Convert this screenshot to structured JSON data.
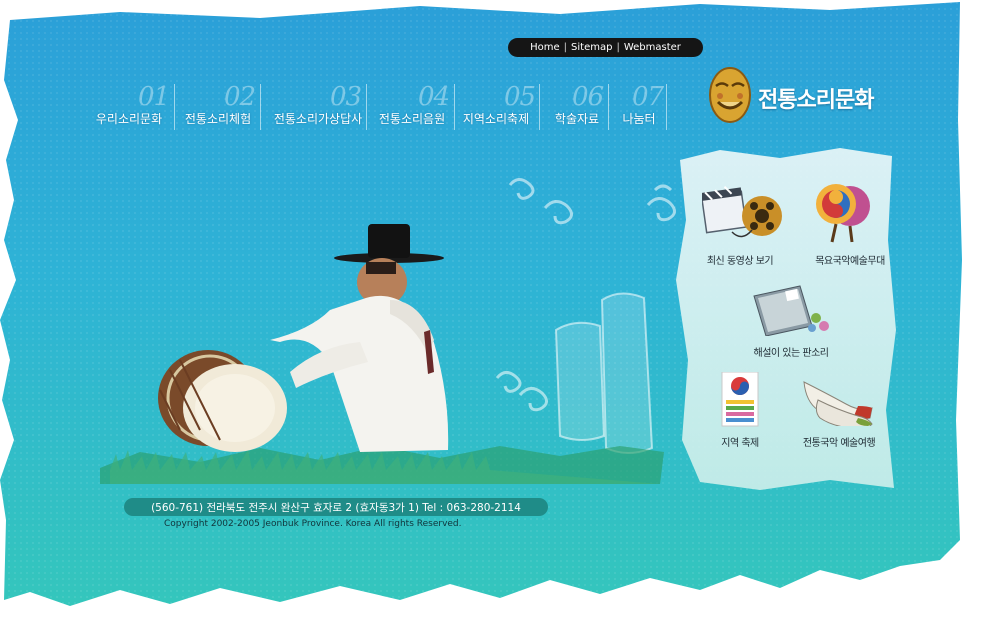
{
  "top_links": {
    "home": "Home",
    "sitemap": "Sitemap",
    "webmaster": "Webmaster",
    "separator": "|"
  },
  "nav": {
    "items": [
      {
        "num": "01",
        "label": "우리소리문화"
      },
      {
        "num": "02",
        "label": "전통소리체험"
      },
      {
        "num": "03",
        "label": "전통소리가상답사"
      },
      {
        "num": "04",
        "label": "전통소리음원"
      },
      {
        "num": "05",
        "label": "지역소리축제"
      },
      {
        "num": "06",
        "label": "학술자료"
      },
      {
        "num": "07",
        "label": "나눔터"
      }
    ]
  },
  "logo": {
    "title": "전통소리문화",
    "icon": "mask-icon"
  },
  "side_menu": {
    "items": [
      {
        "label": "최신 동영상 보기",
        "icon": "video-film-icon"
      },
      {
        "label": "목요국악예술무대",
        "icon": "fan-icon"
      },
      {
        "label": "해설이 있는 판소리",
        "icon": "book-icon"
      },
      {
        "label": "지역 축제",
        "icon": "festival-flag-icon"
      },
      {
        "label": "전통국악 예술여행",
        "icon": "shoes-icon"
      }
    ]
  },
  "footer": {
    "address": "(560-761) 전라북도 전주시 완산구 효자로 2 (효자동3가 1) Tel : 063-280-2114",
    "copyright": "Copyright 2002-2005 Jeonbuk Province. Korea All rights Reserved."
  },
  "colors": {
    "sky_top": "#2fa3d8",
    "sky_bottom": "#2fc3bd",
    "address_bar": "#1f8c88",
    "pill": "#151515"
  }
}
